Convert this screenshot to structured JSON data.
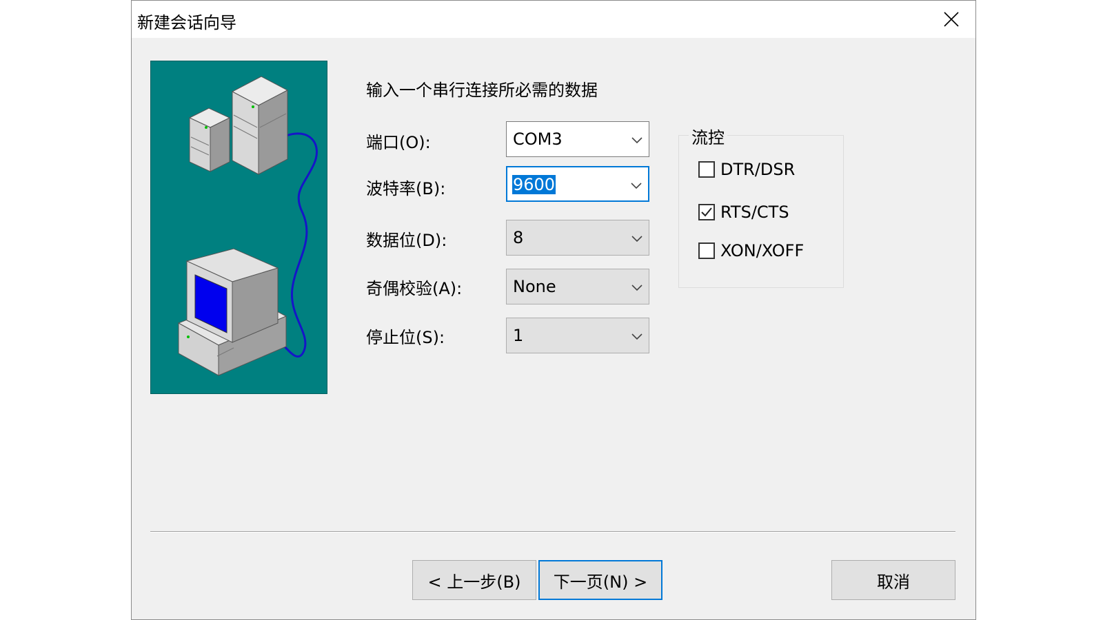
{
  "window": {
    "title": "新建会话向导"
  },
  "heading": "输入一个串行连接所必需的数据",
  "fields": {
    "port": {
      "label": "端口(O):",
      "value": "COM3"
    },
    "baud": {
      "label": "波特率(B):",
      "value": "9600"
    },
    "databits": {
      "label": "数据位(D):",
      "value": "8"
    },
    "parity": {
      "label": "奇偶校验(A):",
      "value": "None"
    },
    "stopbits": {
      "label": "停止位(S):",
      "value": "1"
    }
  },
  "flow_control": {
    "title": "流控",
    "options": [
      {
        "label": "DTR/DSR",
        "checked": false
      },
      {
        "label": "RTS/CTS",
        "checked": true
      },
      {
        "label": "XON/XOFF",
        "checked": false
      }
    ]
  },
  "buttons": {
    "back": "< 上一步(B)",
    "next": "下一页(N) >",
    "cancel": "取消"
  },
  "colors": {
    "illustration_bg": "#008080",
    "accent": "#0078d7",
    "dialog_bg": "#f0f0f0"
  }
}
